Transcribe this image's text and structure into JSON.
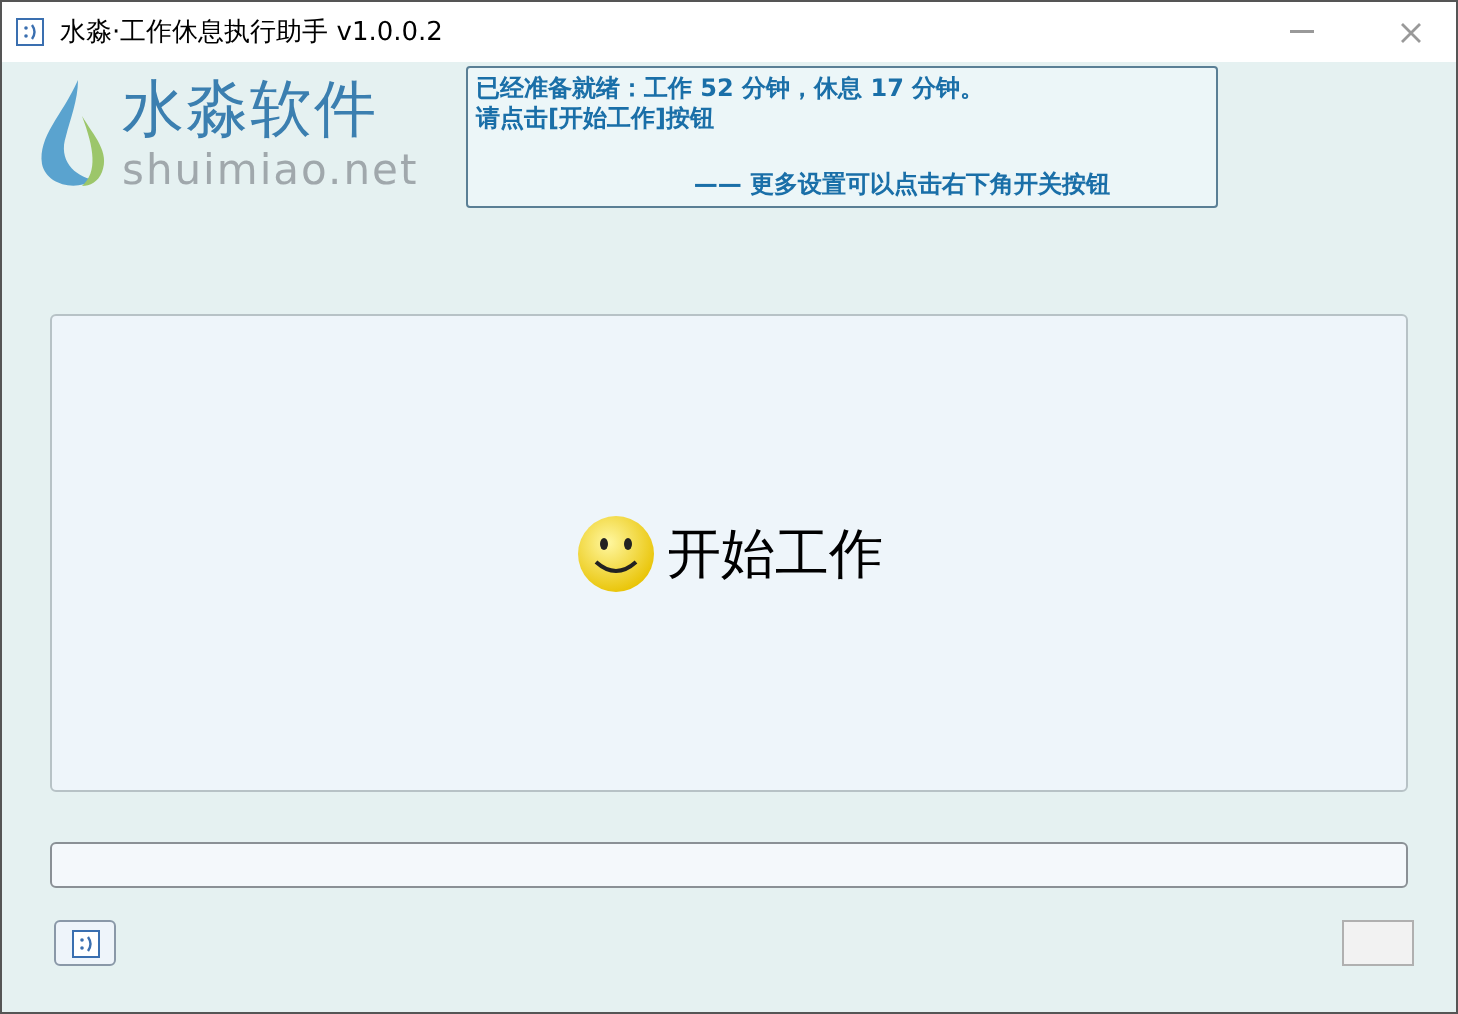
{
  "window": {
    "title": "水淼·工作休息执行助手 v1.0.0.2"
  },
  "logo": {
    "name": "水淼软件",
    "site": "shuimiao.net"
  },
  "info": {
    "lines": [
      "已经准备就绪：工作 52 分钟，休息 17 分钟。",
      "请点击[开始工作]按钮"
    ],
    "hint": "—— 更多设置可以点击右下角开关按钮"
  },
  "start_button": {
    "label": "开始工作"
  },
  "progress": {
    "level": 0
  }
}
